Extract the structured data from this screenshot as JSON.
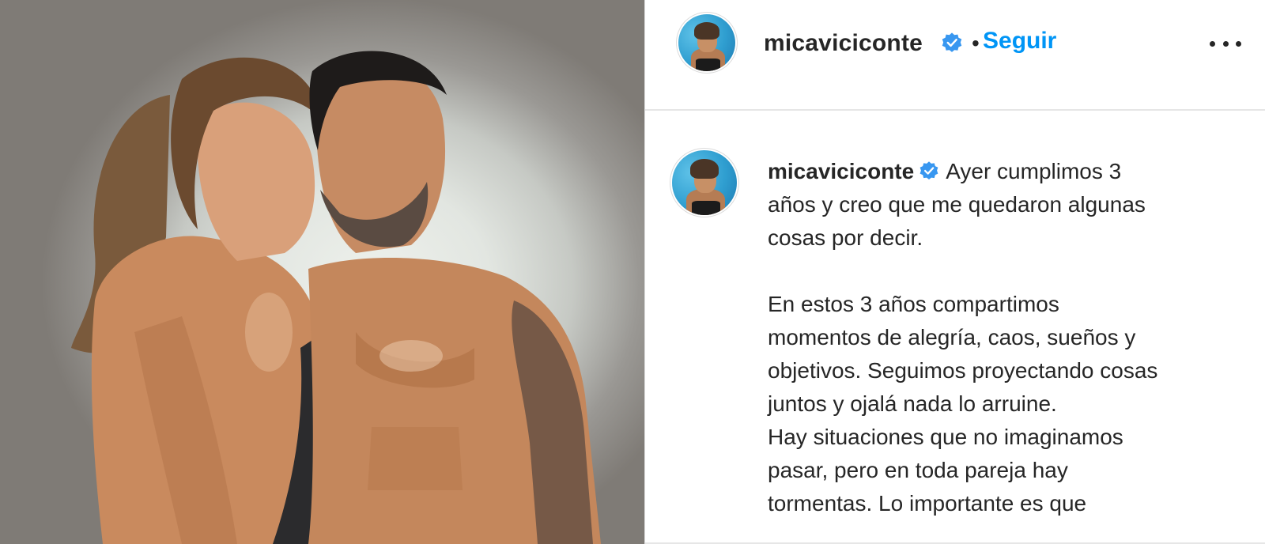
{
  "post": {
    "username": "micaviciconte",
    "follow_label": "Seguir",
    "separator": "•",
    "caption_lines": [
      "Ayer cumplimos 3",
      "años y creo que me quedaron algunas",
      "cosas por decir.",
      "",
      "En estos 3 años compartimos",
      "momentos de alegría, caos, sueños y",
      "objetivos. Seguimos proyectando cosas",
      "juntos y ojalá nada lo arruine.",
      "Hay situaciones que no imaginamos",
      "pasar, pero en toda pareja hay",
      "tormentas. Lo importante es que"
    ]
  },
  "colors": {
    "link_blue": "#0095f6",
    "verified_blue": "#3897f0",
    "text": "#262626",
    "divider": "#e6e6e6"
  },
  "icons": {
    "verified": "verified-badge-icon",
    "more": "more-options-icon"
  }
}
